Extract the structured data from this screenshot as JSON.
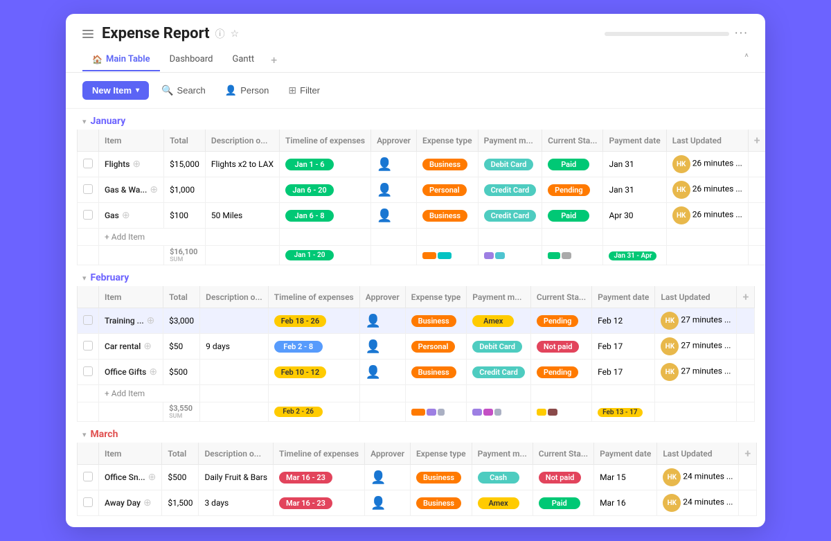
{
  "app": {
    "title": "Expense Report",
    "more": "···",
    "tabs": [
      {
        "label": "Main Table",
        "icon": "🏠",
        "active": true
      },
      {
        "label": "Dashboard",
        "icon": "",
        "active": false
      },
      {
        "label": "Gantt",
        "icon": "",
        "active": false
      }
    ],
    "add_tab": "+",
    "collapse": "^"
  },
  "toolbar": {
    "new_item": "New Item",
    "search": "Search",
    "person": "Person",
    "filter": "Filter"
  },
  "sections": [
    {
      "id": "january",
      "title": "January",
      "color_class": "january",
      "columns": [
        "",
        "Item",
        "Total",
        "Description o...",
        "Timeline of expenses",
        "Approver",
        "Expense type",
        "Payment m...",
        "Current Sta...",
        "Payment date",
        "Last Updated",
        "+"
      ],
      "rows": [
        {
          "item": "Flights",
          "total": "$15,000",
          "description": "Flights x2 to LAX",
          "timeline": "Jan 1 - 6",
          "timeline_color": "pill-green",
          "approver": "person",
          "expense_type": "Business",
          "expense_color": "badge-business",
          "payment_method": "Debit Card",
          "payment_color": "badge-debit",
          "status": "Paid",
          "status_color": "badge-paid",
          "payment_date": "Jan 31",
          "last_updated": "26 minutes ...",
          "avatar": "HK"
        },
        {
          "item": "Gas & Wa...",
          "total": "$1,000",
          "description": "",
          "timeline": "Jan 6 - 20",
          "timeline_color": "pill-green",
          "approver": "person",
          "expense_type": "Personal",
          "expense_color": "badge-personal",
          "payment_method": "Credit Card",
          "payment_color": "badge-credit",
          "status": "Pending",
          "status_color": "badge-pending",
          "payment_date": "Jan 31",
          "last_updated": "26 minutes ...",
          "avatar": "HK"
        },
        {
          "item": "Gas",
          "total": "$100",
          "description": "50 Miles",
          "timeline": "Jan 6 - 8",
          "timeline_color": "pill-green",
          "approver": "person",
          "expense_type": "Business",
          "expense_color": "badge-business",
          "payment_method": "Credit Card",
          "payment_color": "badge-credit",
          "status": "Paid",
          "status_color": "badge-paid",
          "payment_date": "Apr 30",
          "last_updated": "26 minutes ...",
          "avatar": "HK"
        }
      ],
      "sum": "$16,100",
      "sum_timeline": "Jan 1 - 20",
      "sum_timeline_color": "pill-green"
    },
    {
      "id": "february",
      "title": "February",
      "color_class": "february",
      "columns": [
        "",
        "Item",
        "Total",
        "Description o...",
        "Timeline of expenses",
        "Approver",
        "Expense type",
        "Payment m...",
        "Current Sta...",
        "Payment date",
        "Last Updated",
        "+"
      ],
      "rows": [
        {
          "item": "Training ...",
          "total": "$3,000",
          "description": "",
          "timeline": "Feb 18 - 26",
          "timeline_color": "pill-yellow",
          "approver": "person",
          "expense_type": "Business",
          "expense_color": "badge-business",
          "payment_method": "Amex",
          "payment_color": "badge-amex",
          "status": "Pending",
          "status_color": "badge-pending",
          "payment_date": "Feb 12",
          "last_updated": "27 minutes ...",
          "avatar": "HK",
          "highlighted": true
        },
        {
          "item": "Car rental",
          "total": "$50",
          "description": "9 days",
          "timeline": "Feb 2 - 8",
          "timeline_color": "pill-blue",
          "approver": "person",
          "expense_type": "Personal",
          "expense_color": "badge-personal",
          "payment_method": "Debit Card",
          "payment_color": "badge-debit",
          "status": "Not paid",
          "status_color": "badge-notpaid",
          "payment_date": "Feb 17",
          "last_updated": "27 minutes ...",
          "avatar": "HK"
        },
        {
          "item": "Office Gifts",
          "total": "$500",
          "description": "",
          "timeline": "Feb 10 - 12",
          "timeline_color": "pill-yellow",
          "approver": "person",
          "expense_type": "Business",
          "expense_color": "badge-business",
          "payment_method": "Credit Card",
          "payment_color": "badge-credit",
          "status": "Pending",
          "status_color": "badge-pending",
          "payment_date": "Feb 17",
          "last_updated": "27 minutes ...",
          "avatar": "HK"
        }
      ],
      "sum": "$3,550",
      "sum_timeline": "Feb 2 - 26",
      "sum_timeline_color": "pill-yellow"
    },
    {
      "id": "march",
      "title": "March",
      "color_class": "march",
      "columns": [
        "",
        "Item",
        "Total",
        "Description o...",
        "Timeline of expenses",
        "Approver",
        "Expense type",
        "Payment m...",
        "Current Sta...",
        "Payment date",
        "Last Updated",
        "+"
      ],
      "rows": [
        {
          "item": "Office Sn...",
          "total": "$500",
          "description": "Daily Fruit & Bars",
          "timeline": "Mar 16 - 23",
          "timeline_color": "pill-red",
          "approver": "person",
          "expense_type": "Business",
          "expense_color": "badge-business",
          "payment_method": "Cash",
          "payment_color": "badge-cash",
          "status": "Not paid",
          "status_color": "badge-notpaid",
          "payment_date": "Mar 15",
          "last_updated": "24 minutes ...",
          "avatar": "HK"
        },
        {
          "item": "Away Day",
          "total": "$1,500",
          "description": "3 days",
          "timeline": "Mar 16 - 23",
          "timeline_color": "pill-red",
          "approver": "person",
          "expense_type": "Business",
          "expense_color": "badge-business",
          "payment_method": "Amex",
          "payment_color": "badge-amex",
          "status": "Paid",
          "status_color": "badge-paid",
          "payment_date": "Mar 16",
          "last_updated": "24 minutes ...",
          "avatar": "HK"
        }
      ],
      "sum": "",
      "sum_timeline": ""
    }
  ],
  "add_item_label": "+ Add Item"
}
